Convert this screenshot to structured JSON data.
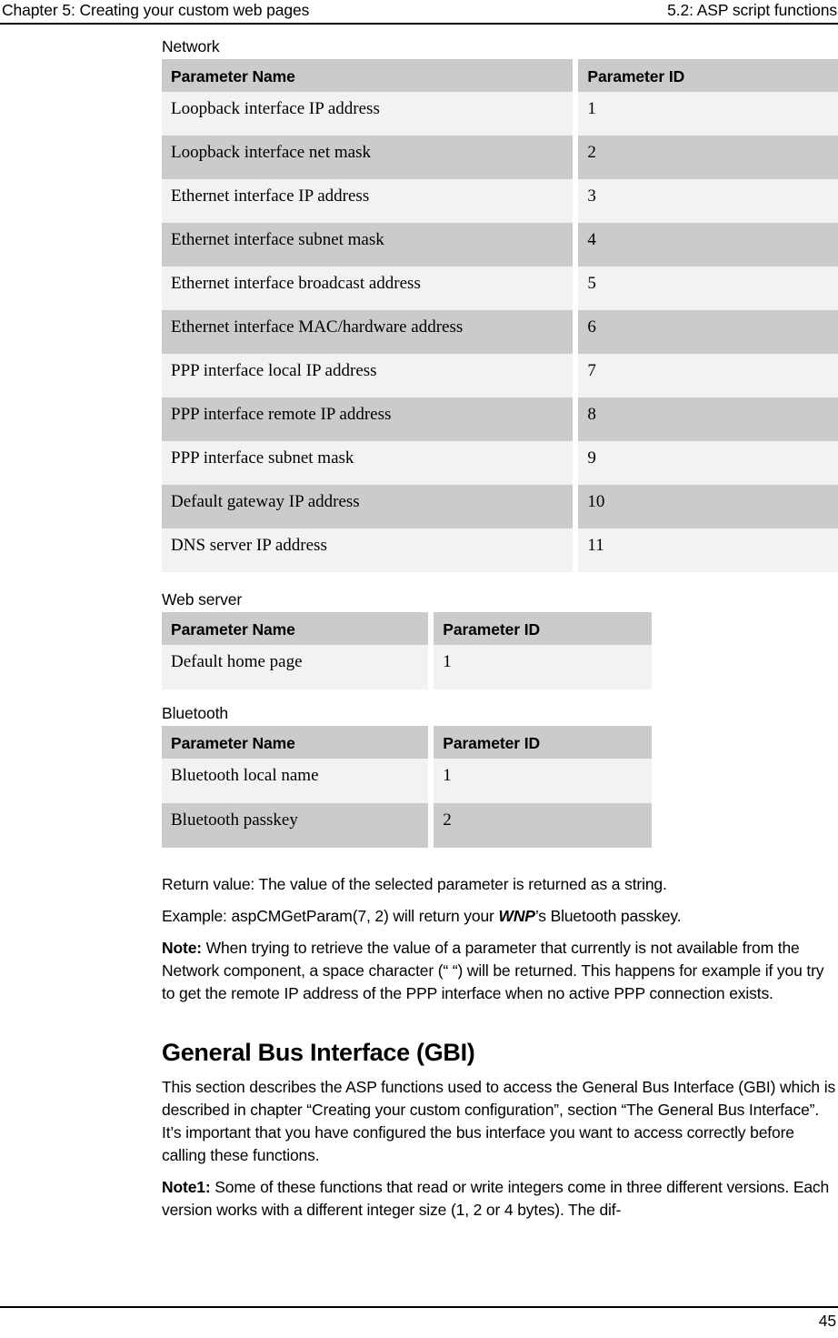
{
  "running_head": {
    "left": "Chapter 5: Creating your custom web pages",
    "right": "5.2: ASP script functions"
  },
  "columns": {
    "name": "Parameter Name",
    "id": "Parameter ID"
  },
  "sections": {
    "network": {
      "caption": "Network",
      "rows": [
        {
          "name": "Loopback interface IP address",
          "id": "1"
        },
        {
          "name": "Loopback interface net mask",
          "id": "2"
        },
        {
          "name": "Ethernet interface IP address",
          "id": "3"
        },
        {
          "name": "Ethernet interface subnet mask",
          "id": "4"
        },
        {
          "name": "Ethernet interface broadcast address",
          "id": "5"
        },
        {
          "name": "Ethernet interface MAC/hardware address",
          "id": "6"
        },
        {
          "name": "PPP interface local IP address",
          "id": "7"
        },
        {
          "name": "PPP interface remote IP address",
          "id": "8"
        },
        {
          "name": "PPP interface subnet mask",
          "id": "9"
        },
        {
          "name": "Default gateway IP address",
          "id": "10"
        },
        {
          "name": "DNS server IP address",
          "id": "11"
        }
      ]
    },
    "web_server": {
      "caption": "Web server",
      "rows": [
        {
          "name": "Default home page",
          "id": "1"
        }
      ]
    },
    "bluetooth": {
      "caption": "Bluetooth",
      "rows": [
        {
          "name": "Bluetooth local name",
          "id": "1"
        },
        {
          "name": "Bluetooth passkey",
          "id": "2"
        }
      ]
    }
  },
  "body": {
    "return_value": "Return value: The value of the selected parameter is returned as a string.",
    "example_prefix": "Example: aspCMGetParam(7, 2) will return your ",
    "example_product": "WNP",
    "example_suffix": "’s Bluetooth passkey.",
    "note_label": "Note:",
    "note_text": " When trying to retrieve the value of a parameter that currently is not available from the Network component, a space character (“ “) will be returned. This happens for example if you try to get the remote IP address of the PPP interface when no active PPP connection exists.",
    "gbi_heading": "General Bus Interface (GBI)",
    "gbi_paragraph": "This section describes the ASP functions used to access the General Bus Interface (GBI) which is described in chapter “Creating your custom configuration”, section “The General Bus Interface”. It’s important that you have configured the bus interface you want to access correctly before calling these functions.",
    "note1_label": "Note1:",
    "note1_text": " Some of these functions that read or write integers come in three different versions. Each version works with a different integer size (1, 2 or 4 bytes). The dif-"
  },
  "footer": {
    "page_number": "45"
  },
  "colors": {
    "row_dark": "#cbcbcb",
    "row_light": "#f2f2f2",
    "rule": "#000000",
    "text": "#000000"
  }
}
